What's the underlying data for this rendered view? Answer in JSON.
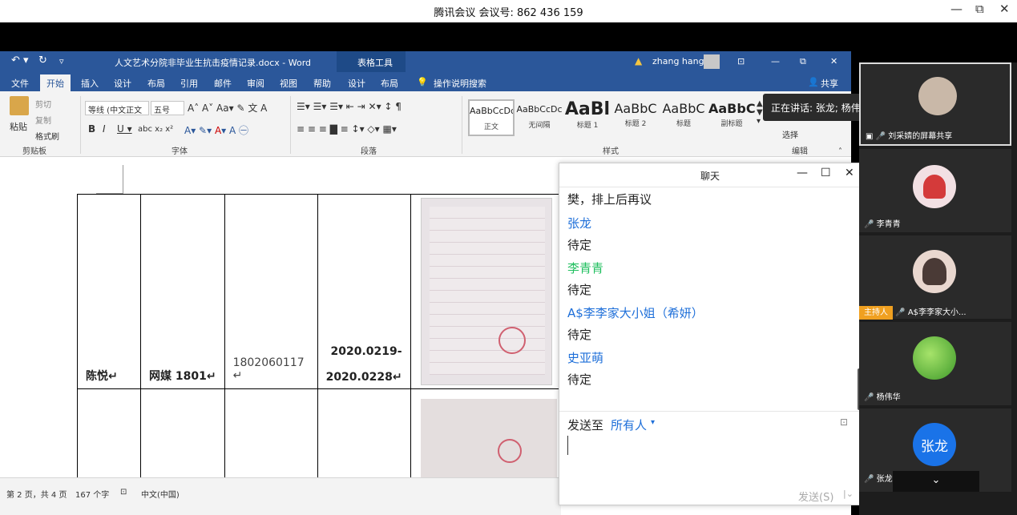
{
  "meeting_bar": {
    "title": "腾讯会议 会议号: 862 436 159",
    "min": "—",
    "max": "⧉",
    "close": "✕"
  },
  "word": {
    "title": "人文艺术分院非毕业生抗击疫情记录.docx - Word",
    "tools_label": "表格工具",
    "user": "zhang hang",
    "warning_icon": "warning-icon",
    "tabs": [
      "文件",
      "开始",
      "插入",
      "设计",
      "布局",
      "引用",
      "邮件",
      "审阅",
      "视图",
      "帮助",
      "设计",
      "布局"
    ],
    "tell_me": "操作说明搜索",
    "share": "共享",
    "clipboard": {
      "paste": "粘贴",
      "cut": "剪切",
      "copy": "复制",
      "format_painter": "格式刷",
      "label": "剪贴板"
    },
    "font": {
      "name": "等线 (中文正文",
      "size": "五号",
      "label": "字体"
    },
    "paragraph_label": "段落",
    "styles": {
      "label": "样式",
      "items": [
        {
          "preview": "AaBbCcDc",
          "name": "正文"
        },
        {
          "preview": "AaBbCcDc",
          "name": "无间隔"
        },
        {
          "preview": "AaBl",
          "name": "标题 1"
        },
        {
          "preview": "AaBbC",
          "name": "标题 2"
        },
        {
          "preview": "AaBbC",
          "name": "标题"
        },
        {
          "preview": "AaBbC",
          "name": "副标题"
        }
      ]
    },
    "editing": {
      "select": "选择",
      "label": "编辑"
    },
    "table": {
      "row1": [
        "陈悦",
        "网媒 1801",
        "1802060117",
        "2020.0219-",
        "2020.0228"
      ]
    },
    "status": {
      "page": "第 2 页，共 4 页",
      "words": "167 个字",
      "lang": "中文(中国)"
    }
  },
  "speaking": {
    "text": "正在讲话: 张龙; 杨伟华;"
  },
  "chat": {
    "title": "聊天",
    "messages": [
      {
        "text": "樊，排上后再议"
      },
      {
        "name": "张龙",
        "color": "#1e6fd9",
        "text": "待定"
      },
      {
        "name": "李青青",
        "color": "#1fbf5e",
        "text": "待定"
      },
      {
        "name": "A$李李家大小姐（希妍）",
        "color": "#1e6fd9",
        "text": "待定"
      },
      {
        "name": "史亚萌",
        "color": "#1e6fd9",
        "text": "待定"
      }
    ],
    "send_to_label": "发送至",
    "send_to_target": "所有人",
    "send_button": "发送(S)"
  },
  "participants": [
    {
      "name": "刘采婧的屏幕共享",
      "mic": "mic-icon"
    },
    {
      "name": "李青青",
      "mic": "mic-muted-icon"
    },
    {
      "name": "A$李李家大小...",
      "host": "主持人",
      "mic": "mic-icon"
    },
    {
      "name": "杨伟华",
      "mic": "mic-icon"
    },
    {
      "name": "张龙",
      "avatar_text": "张龙",
      "mic": "mic-active-icon"
    }
  ],
  "colors": {
    "word_blue": "#2b579a",
    "chat_name_blue": "#1e6fd9",
    "chat_name_green": "#1fbf5e",
    "host_badge": "#f0a020",
    "avatar_blue": "#1a73e8"
  }
}
